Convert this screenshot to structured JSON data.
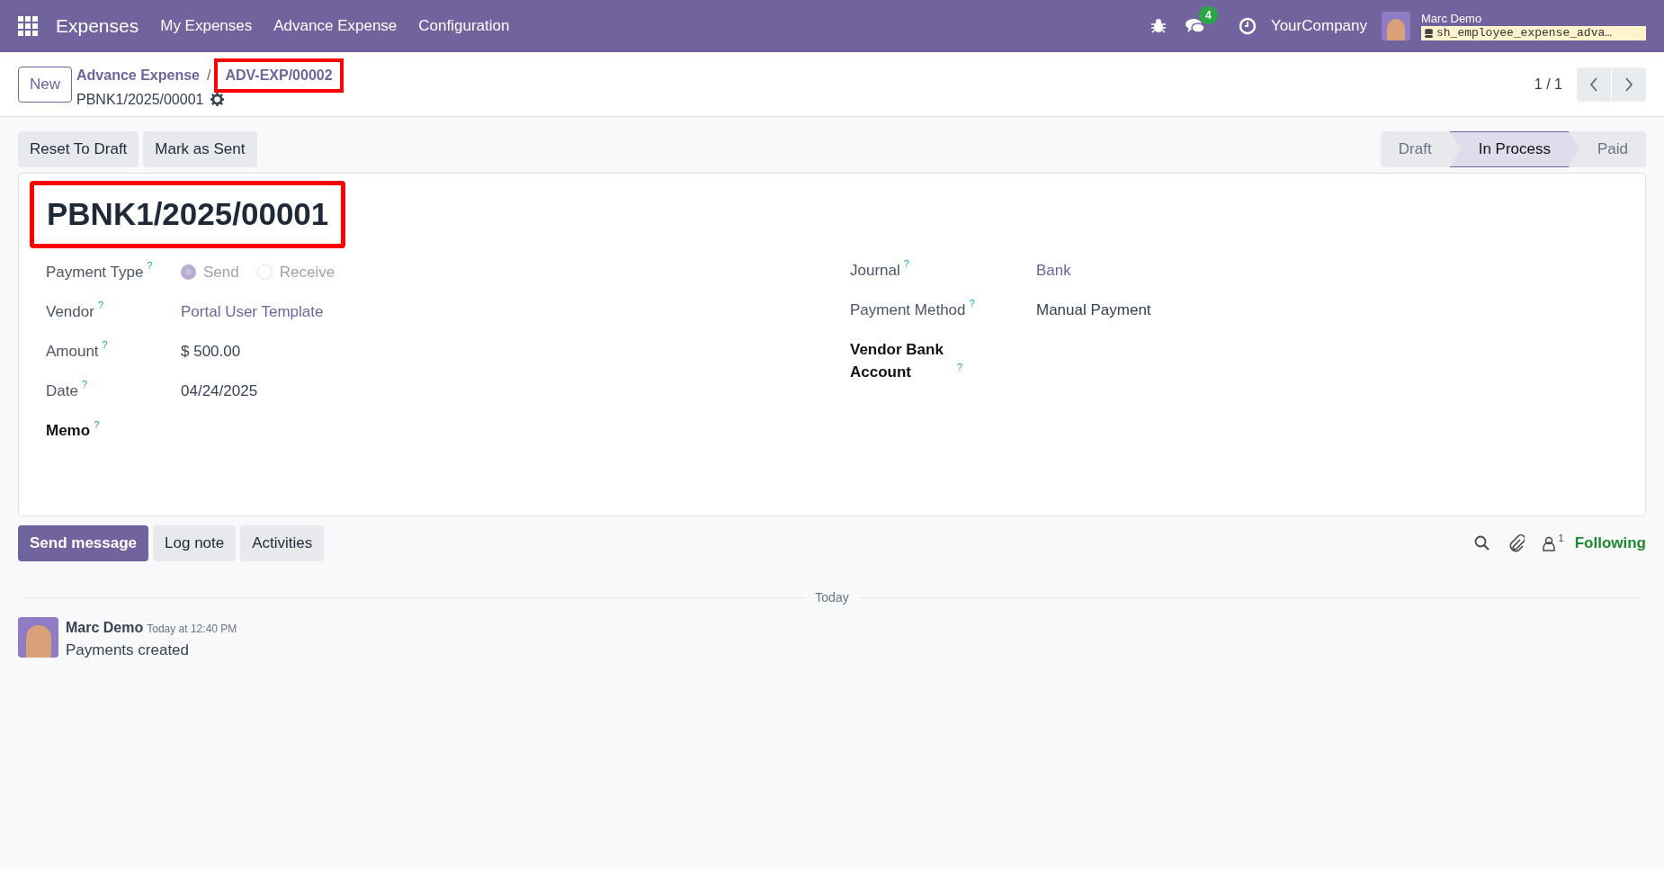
{
  "navbar": {
    "app": "Expenses",
    "menus": [
      "My Expenses",
      "Advance Expense",
      "Configuration"
    ],
    "chat_count": "4",
    "company": "YourCompany",
    "user": "Marc Demo",
    "database": "sh_employee_expense_adva…"
  },
  "control_panel": {
    "new_button": "New",
    "breadcrumb": {
      "parent": "Advance Expense",
      "separator": "/",
      "current": "ADV-EXP/00002",
      "highlighted": true
    },
    "record": "PBNK1/2025/00001",
    "pager": "1 / 1"
  },
  "actions": [
    "Reset To Draft",
    "Mark as Sent"
  ],
  "stages": [
    {
      "label": "Draft",
      "selected": false
    },
    {
      "label": "In Process",
      "selected": true
    },
    {
      "label": "Paid",
      "selected": false
    }
  ],
  "title": {
    "text": "PBNK1/2025/00001",
    "highlighted": true
  },
  "left_fields": [
    {
      "label": "Payment Type",
      "help": "?",
      "kind": "radio",
      "options": [
        {
          "label": "Send",
          "selected": true
        },
        {
          "label": "Receive",
          "selected": false
        }
      ]
    },
    {
      "label": "Vendor",
      "help": "?",
      "kind": "link",
      "value": "Portal User Template"
    },
    {
      "label": "Amount",
      "help": "?",
      "kind": "text",
      "value": "$ 500.00"
    },
    {
      "label": "Date",
      "help": "?",
      "kind": "text",
      "value": "04/24/2025"
    },
    {
      "label": "Memo",
      "help": "?",
      "kind": "empty"
    }
  ],
  "right_fields": [
    {
      "label": "Journal",
      "help": "?",
      "kind": "link",
      "value": "Bank"
    },
    {
      "label": "Payment Method",
      "help": "?",
      "kind": "text",
      "value": "Manual Payment"
    },
    {
      "label": "Vendor Bank Account",
      "help": "?",
      "kind": "empty"
    }
  ],
  "chatter": {
    "buttons": [
      {
        "label": "Send message",
        "selected": true
      },
      {
        "label": "Log note",
        "selected": false
      },
      {
        "label": "Activities",
        "selected": false
      }
    ],
    "followers": "1",
    "follow_label": "Following",
    "divider": "Today",
    "messages": [
      {
        "author": "Marc Demo",
        "time": "Today at 12:40 PM",
        "body": "Payments created"
      }
    ]
  }
}
